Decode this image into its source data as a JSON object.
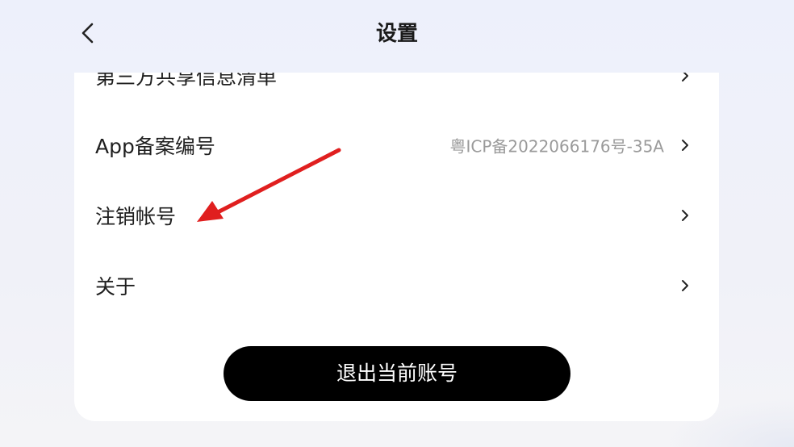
{
  "header": {
    "title": "设置",
    "back_icon": "chevron-left-icon"
  },
  "settings": {
    "items": [
      {
        "label": "第三方共享信息清单",
        "value": ""
      },
      {
        "label": "App备案编号",
        "value": "粤ICP备2022066176号-35A"
      },
      {
        "label": "注销帐号",
        "value": ""
      },
      {
        "label": "关于",
        "value": ""
      }
    ]
  },
  "logout": {
    "label": "退出当前账号"
  },
  "annotation": {
    "arrow_color": "#e01f1f",
    "target": "注销帐号"
  },
  "colors": {
    "header_bg": "#eef1fb",
    "card_bg": "#ffffff",
    "button_bg": "#000000",
    "value_text": "#9a9a9a"
  }
}
